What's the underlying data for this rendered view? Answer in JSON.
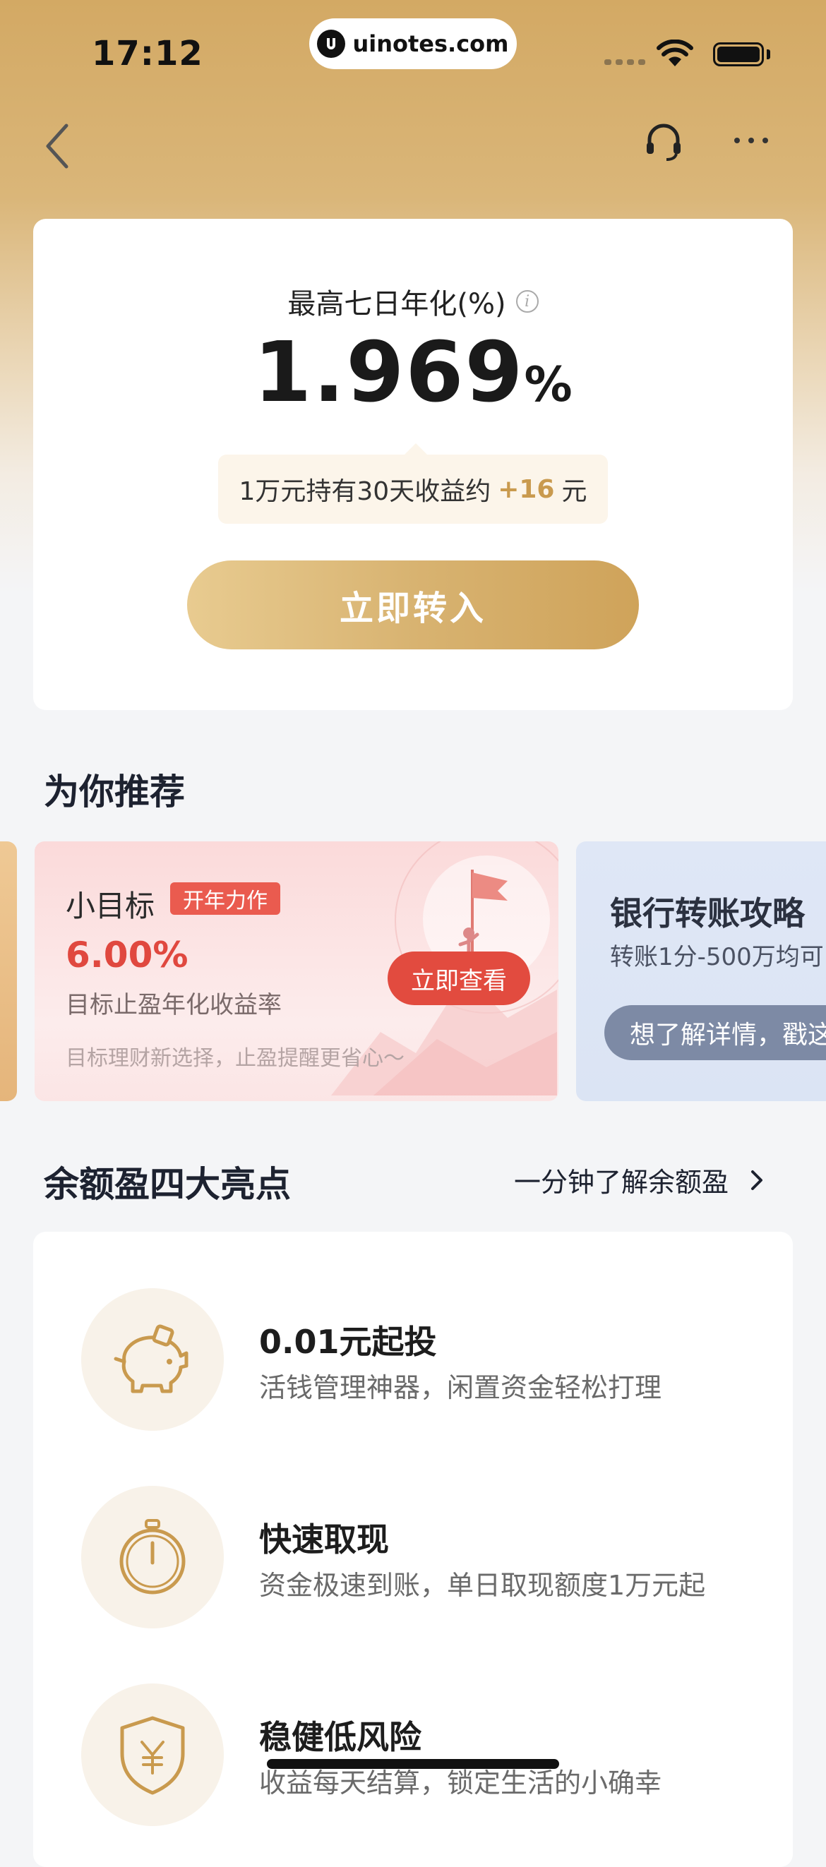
{
  "status_bar": {
    "time": "17:12",
    "url": "uinotes.com"
  },
  "hero": {
    "rate_label": "最高七日年化(%)",
    "rate_value": "1.969",
    "rate_unit": "%",
    "tip_prefix": "1万元持有30天收益约",
    "tip_gain": "+16",
    "tip_suffix": "元",
    "cta_label": "立即转入"
  },
  "recommend": {
    "title": "为你推荐",
    "card1": {
      "title": "小目标",
      "tag": "开年力作",
      "rate": "6.00%",
      "rate_label": "目标止盈年化收益率",
      "desc": "目标理财新选择，止盈提醒更省心～",
      "button": "立即查看"
    },
    "card2": {
      "title": "银行转账攻略",
      "subtitle": "转账1分-500万均可",
      "pill": "想了解详情，戳这"
    }
  },
  "highlights": {
    "title": "余额盈四大亮点",
    "link": "一分钟了解余额盈",
    "items": [
      {
        "title": "0.01元起投",
        "desc": "活钱管理神器，闲置资金轻松打理",
        "icon": "piggy-bank-icon"
      },
      {
        "title": "快速取现",
        "desc": "资金极速到账，单日取现额度1万元起",
        "icon": "stopwatch-icon"
      },
      {
        "title": "稳健低风险",
        "desc": "收益每天结算，锁定生活的小确幸",
        "icon": "shield-yuan-icon"
      }
    ]
  },
  "colors": {
    "gold": "#c99a4e",
    "red": "#e24b3f",
    "text": "#1d2230"
  }
}
